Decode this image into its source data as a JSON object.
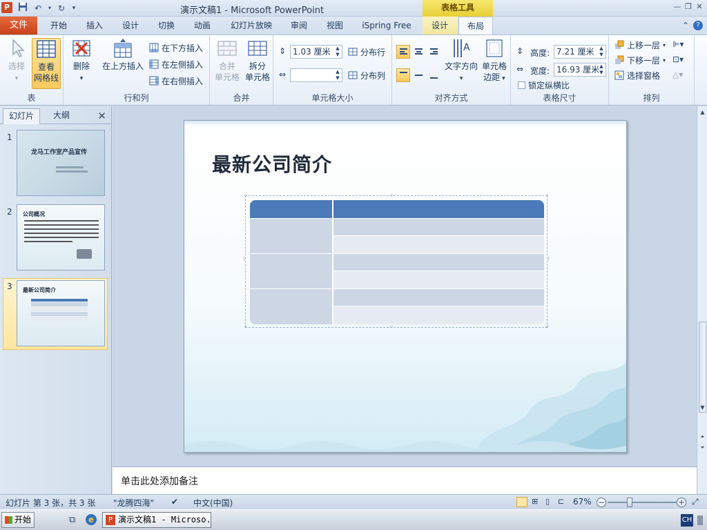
{
  "titlebar": {
    "title": "演示文稿1 - Microsoft PowerPoint",
    "context_title": "表格工具",
    "app_icon": "P"
  },
  "tabs": {
    "file": "文件",
    "items": [
      "开始",
      "插入",
      "设计",
      "切换",
      "动画",
      "幻灯片放映",
      "审阅",
      "视图",
      "iSpring Free"
    ],
    "ctx_items": [
      "设计",
      "布局"
    ]
  },
  "ribbon": {
    "groups": {
      "table": {
        "label": "表",
        "select": "选择",
        "gridlines_1": "查看",
        "gridlines_2": "网格线"
      },
      "rows_cols": {
        "label": "行和列",
        "delete": "删除",
        "insert_above": "在上方插入",
        "insert_below": "在下方插入",
        "insert_left": "在左侧插入",
        "insert_right": "在右侧插入"
      },
      "merge": {
        "label": "合并",
        "merge_1": "合并",
        "merge_2": "单元格",
        "split_1": "拆分",
        "split_2": "单元格"
      },
      "cell_size": {
        "label": "单元格大小",
        "height_value": "1.03 厘米",
        "width_value": "",
        "distribute_rows": "分布行",
        "distribute_cols": "分布列"
      },
      "alignment": {
        "label": "对齐方式",
        "text_dir_1": "文字方向",
        "margins_1": "单元格",
        "margins_2": "边距"
      },
      "table_size": {
        "label": "表格尺寸",
        "height_label": "高度:",
        "height_value": "7.21 厘米",
        "width_label": "宽度:",
        "width_value": "16.93 厘米",
        "lock": "锁定纵横比"
      },
      "arrange": {
        "label": "排列",
        "bring_forward": "上移一层",
        "send_backward": "下移一层",
        "selection_pane": "选择窗格"
      }
    }
  },
  "leftpanel": {
    "tab_slides": "幻灯片",
    "tab_outline": "大纲",
    "thumbs": [
      {
        "num": "1",
        "title": "龙马工作室产品宣传"
      },
      {
        "num": "2",
        "title": "公司概况"
      },
      {
        "num": "3",
        "title": "最新公司简介"
      }
    ]
  },
  "slide": {
    "title": "最新公司简介"
  },
  "notes": {
    "placeholder": "单击此处添加备注"
  },
  "status": {
    "slide_info": "幻灯片 第 3 张，共 3 张",
    "theme": "\"龙腾四海\"",
    "language": "中文(中国)",
    "zoom": "67%"
  },
  "taskbar": {
    "start": "开始",
    "task": "演示文稿1 - Microso...",
    "ime": "CH"
  },
  "colors": {
    "file_tab": "#d24726",
    "table_header": "#4a7ab8",
    "cell_dark": "#cdd6e5",
    "cell_light": "#e6ebf2",
    "context_tab": "#f1e06a"
  }
}
